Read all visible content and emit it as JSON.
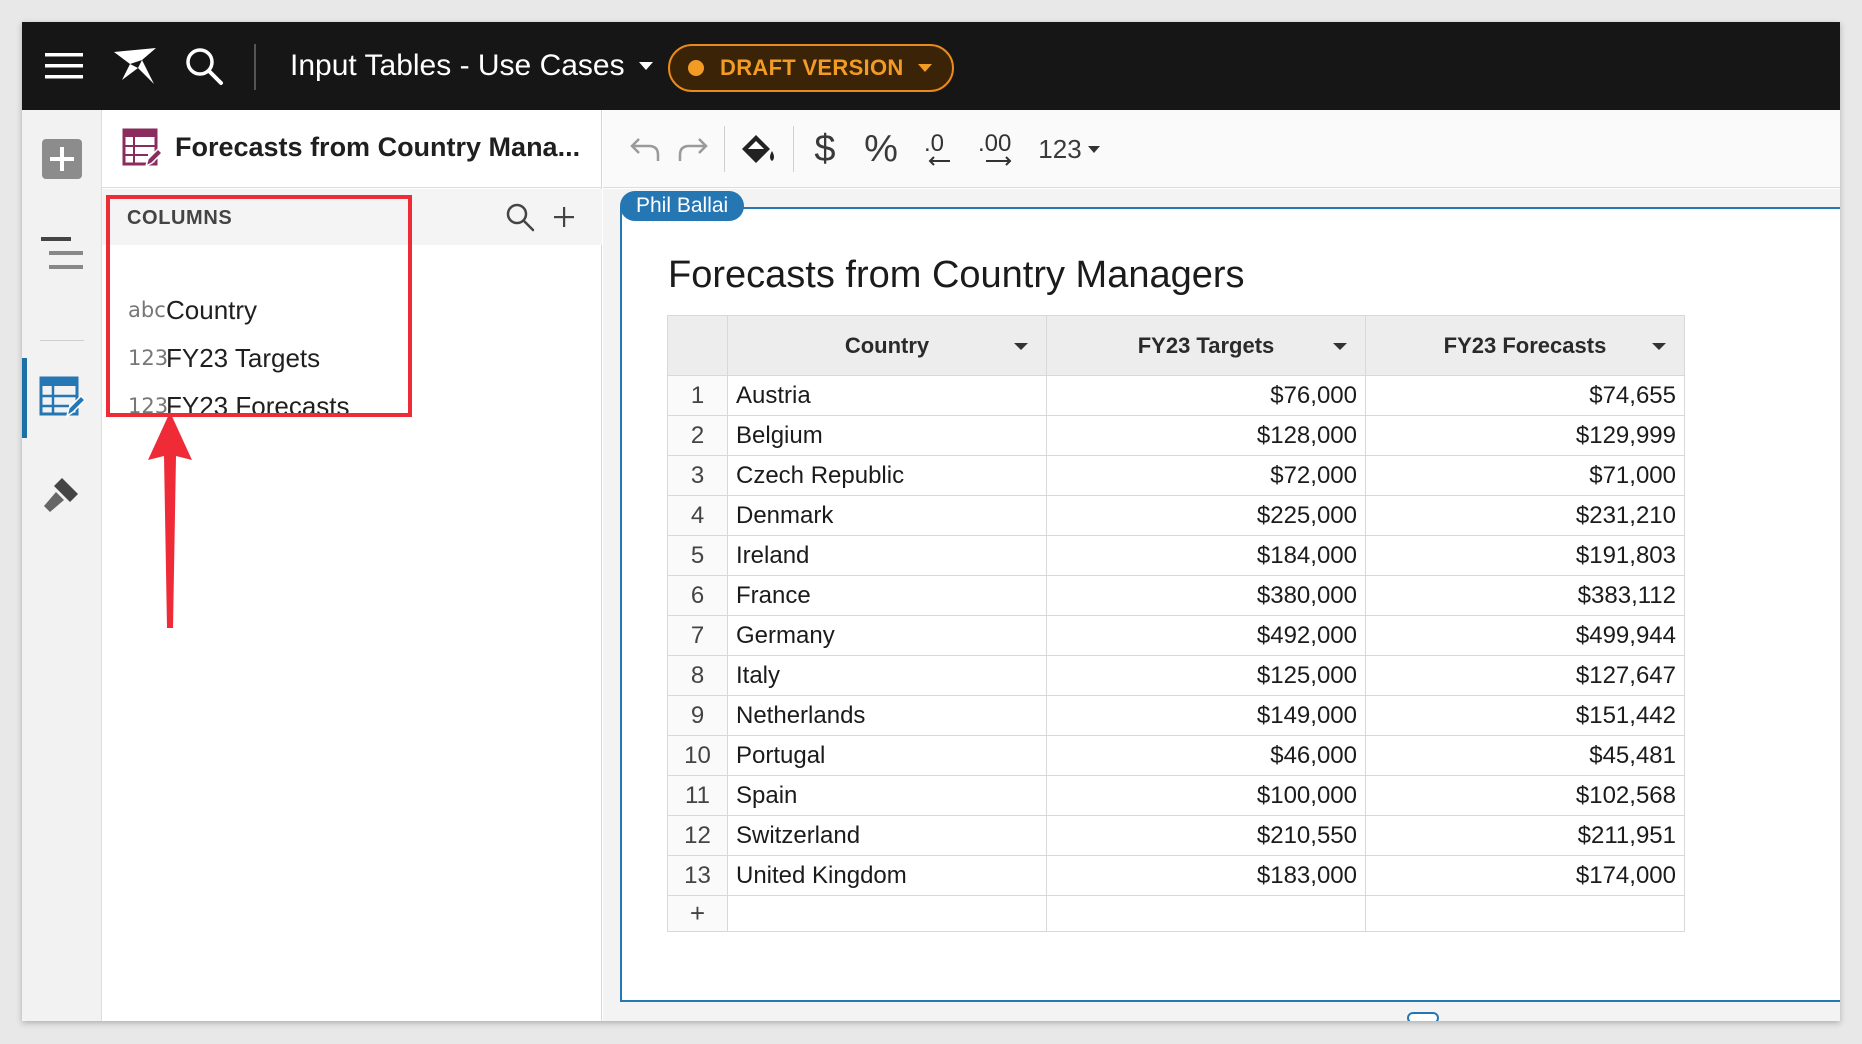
{
  "topbar": {
    "doc_title": "Input Tables - Use Cases",
    "draft_label": "DRAFT VERSION",
    "draft_color": "#f29b25"
  },
  "panel": {
    "title": "Forecasts from Country Mana...",
    "columns_label": "COLUMNS",
    "columns": [
      {
        "type": "abc",
        "name": "Country"
      },
      {
        "type": "123",
        "name": "FY23 Targets"
      },
      {
        "type": "123",
        "name": "FY23 Forecasts"
      }
    ]
  },
  "toolbar": {
    "currency_symbol": "$",
    "percent_symbol": "%",
    "decrease_decimals": ".0",
    "increase_decimals": ".00",
    "number_format": "123"
  },
  "canvas": {
    "user_tag": "Phil Ballai",
    "table_title": "Forecasts from Country Managers",
    "headers": [
      "Country",
      "FY23 Targets",
      "FY23 Forecasts"
    ],
    "rows": [
      {
        "n": "1",
        "country": "Austria",
        "target": "$76,000",
        "forecast": "$74,655"
      },
      {
        "n": "2",
        "country": "Belgium",
        "target": "$128,000",
        "forecast": "$129,999"
      },
      {
        "n": "3",
        "country": "Czech Republic",
        "target": "$72,000",
        "forecast": "$71,000"
      },
      {
        "n": "4",
        "country": "Denmark",
        "target": "$225,000",
        "forecast": "$231,210"
      },
      {
        "n": "5",
        "country": "Ireland",
        "target": "$184,000",
        "forecast": "$191,803"
      },
      {
        "n": "6",
        "country": "France",
        "target": "$380,000",
        "forecast": "$383,112"
      },
      {
        "n": "7",
        "country": "Germany",
        "target": "$492,000",
        "forecast": "$499,944"
      },
      {
        "n": "8",
        "country": "Italy",
        "target": "$125,000",
        "forecast": "$127,647"
      },
      {
        "n": "9",
        "country": "Netherlands",
        "target": "$149,000",
        "forecast": "$151,442"
      },
      {
        "n": "10",
        "country": "Portugal",
        "target": "$46,000",
        "forecast": "$45,481"
      },
      {
        "n": "11",
        "country": "Spain",
        "target": "$100,000",
        "forecast": "$102,568"
      },
      {
        "n": "12",
        "country": "Switzerland",
        "target": "$210,550",
        "forecast": "$211,951"
      },
      {
        "n": "13",
        "country": "United Kingdom",
        "target": "$183,000",
        "forecast": "$174,000"
      }
    ],
    "add_row_symbol": "+"
  },
  "annotation": {
    "highlight_color": "#ef2b38"
  },
  "icons": [
    "menu-icon",
    "sigma-logo-icon",
    "search-icon",
    "add-icon",
    "outline-icon",
    "table-edit-icon",
    "paint-brush-icon",
    "undo-icon",
    "redo-icon",
    "paint-bucket-icon",
    "search-columns-icon",
    "add-column-icon"
  ]
}
